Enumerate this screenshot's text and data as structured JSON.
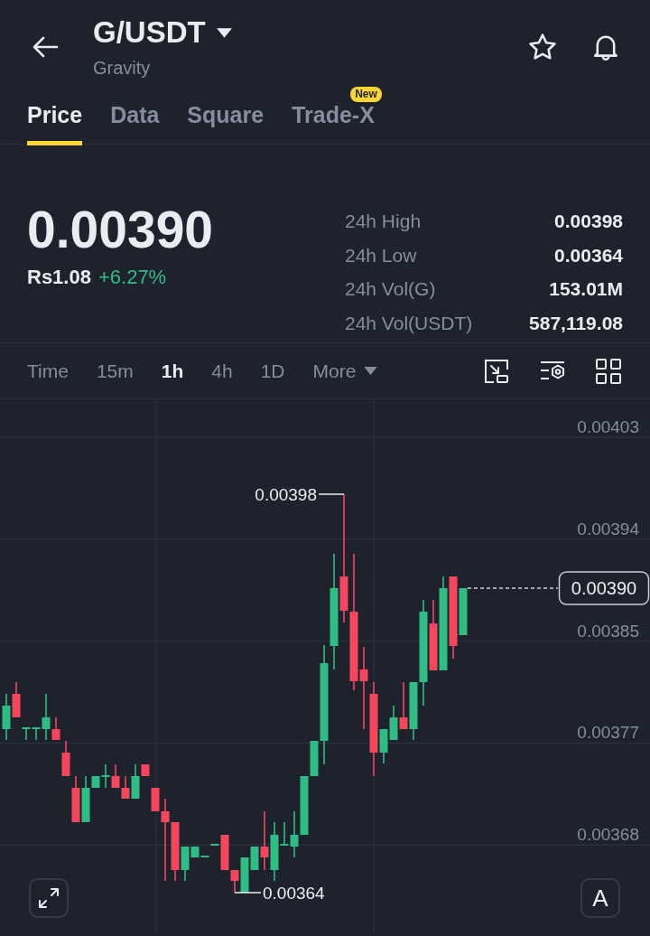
{
  "header": {
    "title": "G/USDT",
    "subtitle": "Gravity"
  },
  "tabs": [
    {
      "label": "Price",
      "selected": true
    },
    {
      "label": "Data",
      "selected": false
    },
    {
      "label": "Square",
      "selected": false
    },
    {
      "label": "Trade-X",
      "selected": false,
      "badge": "New"
    }
  ],
  "ticker": {
    "price": "0.00390",
    "fiat": "Rs1.08",
    "change": "+6.27%",
    "stats": [
      {
        "label": "24h High",
        "value": "0.00398"
      },
      {
        "label": "24h Low",
        "value": "0.00364"
      },
      {
        "label": "24h Vol(G)",
        "value": "153.01M"
      },
      {
        "label": "24h Vol(USDT)",
        "value": "587,119.08"
      }
    ]
  },
  "intervals": [
    {
      "label": "Time",
      "kind": "option",
      "selected": false
    },
    {
      "label": "15m",
      "kind": "option",
      "selected": false
    },
    {
      "label": "1h",
      "kind": "option",
      "selected": true
    },
    {
      "label": "4h",
      "kind": "option",
      "selected": false
    },
    {
      "label": "1D",
      "kind": "option",
      "selected": false
    },
    {
      "label": "More",
      "kind": "menu",
      "selected": false
    }
  ],
  "chart": {
    "price_axis": [
      "0.00403",
      "0.00394",
      "0.00385",
      "0.00377",
      "0.00368"
    ],
    "high_marker": "0.00398",
    "low_marker": "0.00364",
    "last_price": "0.00390",
    "scale_button": "A"
  }
}
